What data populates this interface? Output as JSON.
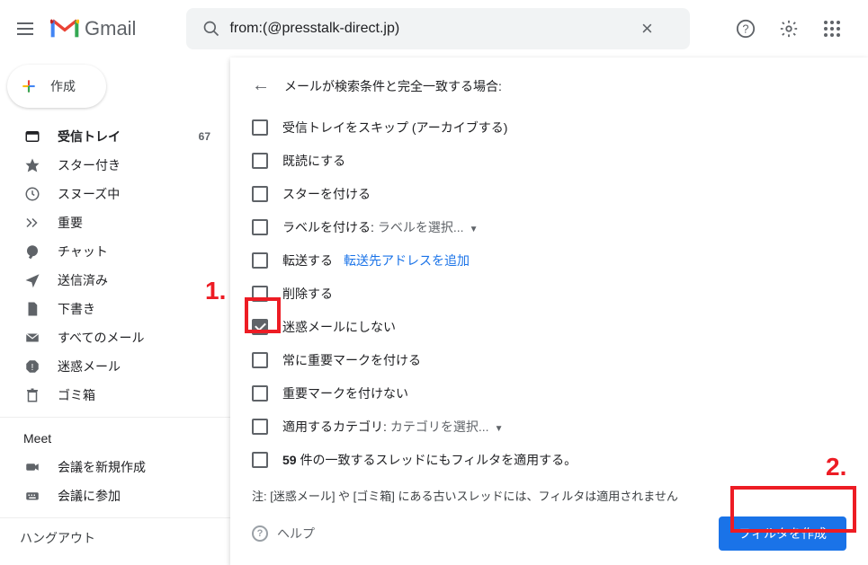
{
  "header": {
    "brand": "Gmail",
    "search_value": "from:(@presstalk-direct.jp)"
  },
  "compose": {
    "label": "作成"
  },
  "nav": [
    {
      "icon": "inbox",
      "label": "受信トレイ",
      "count": "67",
      "bold": true
    },
    {
      "icon": "star",
      "label": "スター付き"
    },
    {
      "icon": "clock",
      "label": "スヌーズ中"
    },
    {
      "icon": "chevrons",
      "label": "重要"
    },
    {
      "icon": "chat",
      "label": "チャット"
    },
    {
      "icon": "send",
      "label": "送信済み"
    },
    {
      "icon": "file",
      "label": "下書き"
    },
    {
      "icon": "mail",
      "label": "すべてのメール"
    },
    {
      "icon": "spam",
      "label": "迷惑メール"
    },
    {
      "icon": "trash",
      "label": "ゴミ箱"
    }
  ],
  "meet": {
    "heading": "Meet",
    "items": [
      {
        "icon": "camera",
        "label": "会議を新規作成"
      },
      {
        "icon": "keyboard",
        "label": "会議に参加"
      }
    ]
  },
  "hangout": {
    "heading": "ハングアウト"
  },
  "filter": {
    "title": "メールが検索条件と完全一致する場合:",
    "options": {
      "skip_inbox": "受信トレイをスキップ (アーカイブする)",
      "mark_read": "既読にする",
      "star": "スターを付ける",
      "apply_label_prefix": "ラベルを付ける:",
      "apply_label_select": "ラベルを選択...",
      "forward": "転送する",
      "forward_add": "転送先アドレスを追加",
      "delete": "削除する",
      "never_spam": "迷惑メールにしない",
      "always_important": "常に重要マークを付ける",
      "never_important": "重要マークを付けない",
      "category_prefix": "適用するカテゴリ:",
      "category_select": "カテゴリを選択...",
      "also_apply_count": "59",
      "also_apply_suffix": " 件の一致するスレッドにもフィルタを適用する。"
    },
    "note": "注: [迷惑メール] や [ゴミ箱] にある古いスレッドには、フィルタは適用されません",
    "help": "ヘルプ",
    "create_button": "フィルタを作成"
  },
  "annotations": {
    "one": "1.",
    "two": "2."
  }
}
